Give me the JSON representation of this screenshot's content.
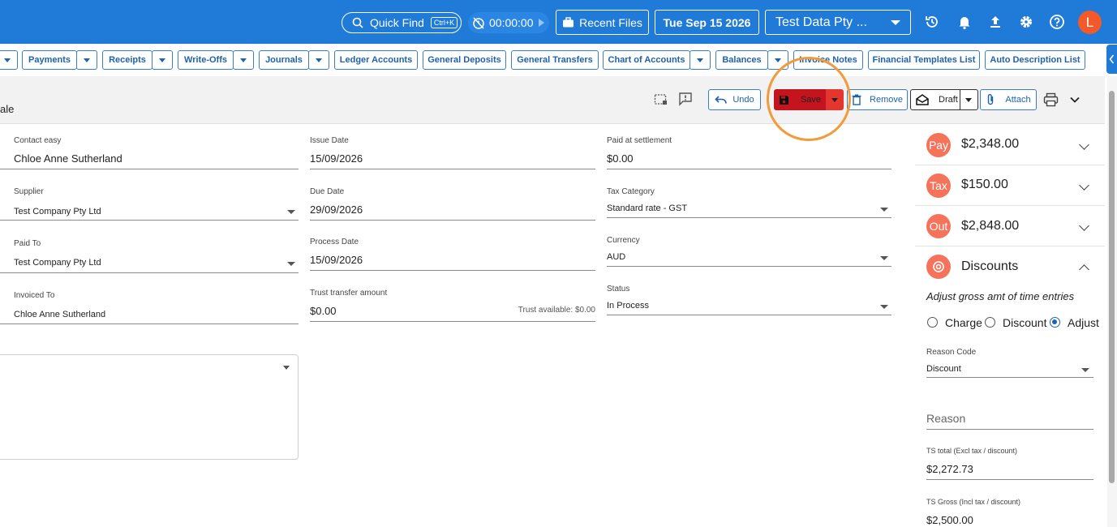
{
  "topbar": {
    "quick_find": "Quick Find",
    "shortcut": "Ctrl+K",
    "timer": "00:00:00",
    "recent_files": "Recent Files",
    "date": "Tue Sep 15 2026",
    "company": "Test Data Pty ...",
    "avatar_letter": "L"
  },
  "nav": {
    "payments": "Payments",
    "receipts": "Receipts",
    "write_offs": "Write-Offs",
    "journals": "Journals",
    "ledger_accounts": "Ledger Accounts",
    "general_deposits": "General Deposits",
    "general_transfers": "General Transfers",
    "chart_of_accounts": "Chart of Accounts",
    "balances": "Balances",
    "invoice_notes": "Invoice Notes",
    "financial_templates": "Financial Templates List",
    "auto_description": "Auto Description List"
  },
  "actionbar": {
    "crumb": "ale",
    "undo": "Undo",
    "save": "Save",
    "remove": "Remove",
    "draft": "Draft",
    "attach": "Attach"
  },
  "form": {
    "contact": {
      "label": "Contact easy",
      "value": "Chloe Anne Sutherland"
    },
    "supplier": {
      "label": "Supplier",
      "value": "Test Company Pty Ltd"
    },
    "paid_to": {
      "label": "Paid To",
      "value": "Test Company Pty Ltd"
    },
    "invoiced_to": {
      "label": "Invoiced To",
      "value": "Chloe Anne Sutherland"
    },
    "issue_date": {
      "label": "Issue Date",
      "value": "15/09/2026"
    },
    "due_date": {
      "label": "Due Date",
      "value": "29/09/2026"
    },
    "process_date": {
      "label": "Process Date",
      "value": "15/09/2026"
    },
    "trust_transfer": {
      "label": "Trust transfer amount",
      "value": "$0.00",
      "available": "Trust available: $0.00"
    },
    "paid_at_settlement": {
      "label": "Paid at settlement",
      "value": "$0.00"
    },
    "tax_category": {
      "label": "Tax Category",
      "value": "Standard rate - GST"
    },
    "currency": {
      "label": "Currency",
      "value": "AUD"
    },
    "status": {
      "label": "Status",
      "value": "In Process"
    }
  },
  "panel": {
    "pay": {
      "badge": "Pay",
      "amount": "$2,348.00"
    },
    "tax": {
      "badge": "Tax",
      "amount": "$150.00"
    },
    "out": {
      "badge": "Out",
      "amount": "$2,848.00"
    },
    "discounts": {
      "title": "Discounts",
      "subtitle": "Adjust gross amt of time entries",
      "options": [
        "Charge",
        "Discount",
        "Adjust"
      ],
      "selected": "Adjust",
      "reason_code_label": "Reason Code",
      "reason_code": "Discount",
      "reason_placeholder": "Reason",
      "ts_total_label": "TS total (Excl tax / discount)",
      "ts_total": "$2,272.73",
      "ts_gross_label": "TS Gross (Incl tax / discount)",
      "ts_gross": "$2,500.00"
    }
  },
  "colors": {
    "brand": "#1f7ad8",
    "save": "#c4141e",
    "badge": "#f4735a",
    "highlight": "#f49a3a"
  }
}
